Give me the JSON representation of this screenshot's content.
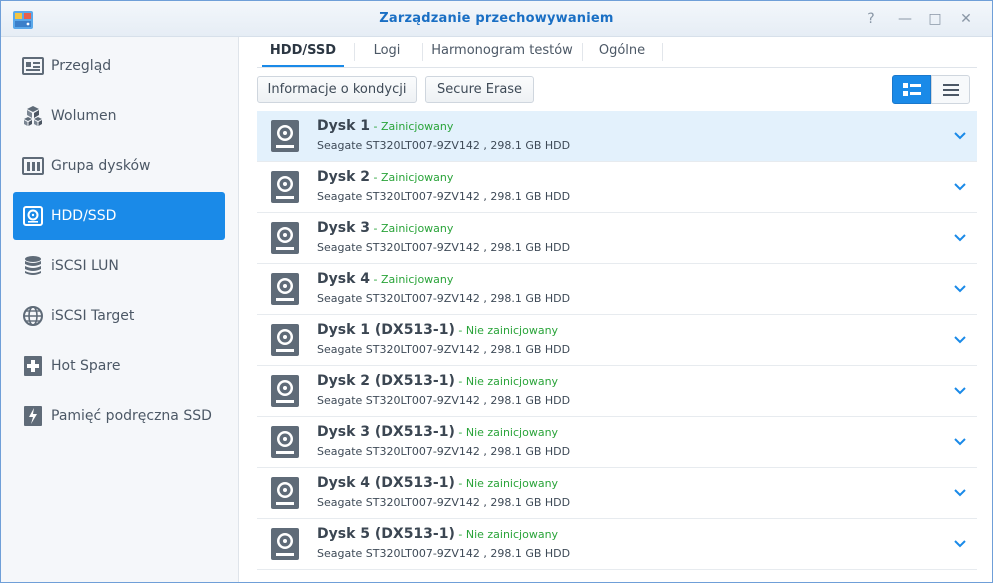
{
  "window": {
    "title": "Zarządzanie przechowywaniem",
    "help": "?",
    "minimize": "—",
    "maximize": "□",
    "close": "✕"
  },
  "colors": {
    "accent": "#1a8ae8",
    "title": "#1a6fc4",
    "status_ok": "#2aa43a",
    "selected_row": "#e3f1fc"
  },
  "sidebar": {
    "items": [
      {
        "label": "Przegląd",
        "icon": "overview-icon",
        "active": false
      },
      {
        "label": "Wolumen",
        "icon": "volume-cubes-icon",
        "active": false
      },
      {
        "label": "Grupa dysków",
        "icon": "disk-group-icon",
        "active": false
      },
      {
        "label": "HDD/SSD",
        "icon": "hdd-icon",
        "active": true
      },
      {
        "label": "iSCSI LUN",
        "icon": "database-icon",
        "active": false
      },
      {
        "label": "iSCSI Target",
        "icon": "globe-icon",
        "active": false
      },
      {
        "label": "Hot Spare",
        "icon": "plus-disk-icon",
        "active": false
      },
      {
        "label": "Pamięć podręczna SSD",
        "icon": "ssd-cache-icon",
        "active": false
      }
    ]
  },
  "tabs": [
    {
      "label": "HDD/SSD",
      "active": true
    },
    {
      "label": "Logi",
      "active": false
    },
    {
      "label": "Harmonogram testów",
      "active": false
    },
    {
      "label": "Ogólne",
      "active": false
    }
  ],
  "toolbar": {
    "health_info": "Informacje o kondycji",
    "secure_erase": "Secure Erase"
  },
  "disks": [
    {
      "name": "Dysk 1",
      "dash": " - ",
      "status": "Zainicjowany",
      "desc": "Seagate ST320LT007-9ZV142 , 298.1 GB HDD",
      "selected": true
    },
    {
      "name": "Dysk 2",
      "dash": " - ",
      "status": "Zainicjowany",
      "desc": "Seagate ST320LT007-9ZV142 , 298.1 GB HDD",
      "selected": false
    },
    {
      "name": "Dysk 3",
      "dash": " - ",
      "status": "Zainicjowany",
      "desc": "Seagate ST320LT007-9ZV142 , 298.1 GB HDD",
      "selected": false
    },
    {
      "name": "Dysk 4",
      "dash": " - ",
      "status": "Zainicjowany",
      "desc": "Seagate ST320LT007-9ZV142 , 298.1 GB HDD",
      "selected": false
    },
    {
      "name": "Dysk 1 (DX513-1)",
      "dash": " - ",
      "status": "Nie zainicjowany",
      "desc": "Seagate ST320LT007-9ZV142 , 298.1 GB HDD",
      "selected": false
    },
    {
      "name": "Dysk 2 (DX513-1)",
      "dash": " - ",
      "status": "Nie zainicjowany",
      "desc": "Seagate ST320LT007-9ZV142 , 298.1 GB HDD",
      "selected": false
    },
    {
      "name": "Dysk 3 (DX513-1)",
      "dash": " - ",
      "status": "Nie zainicjowany",
      "desc": "Seagate ST320LT007-9ZV142 , 298.1 GB HDD",
      "selected": false
    },
    {
      "name": "Dysk 4 (DX513-1)",
      "dash": " - ",
      "status": "Nie zainicjowany",
      "desc": "Seagate ST320LT007-9ZV142 , 298.1 GB HDD",
      "selected": false
    },
    {
      "name": "Dysk 5 (DX513-1)",
      "dash": " - ",
      "status": "Nie zainicjowany",
      "desc": "Seagate ST320LT007-9ZV142 , 298.1 GB HDD",
      "selected": false
    }
  ]
}
